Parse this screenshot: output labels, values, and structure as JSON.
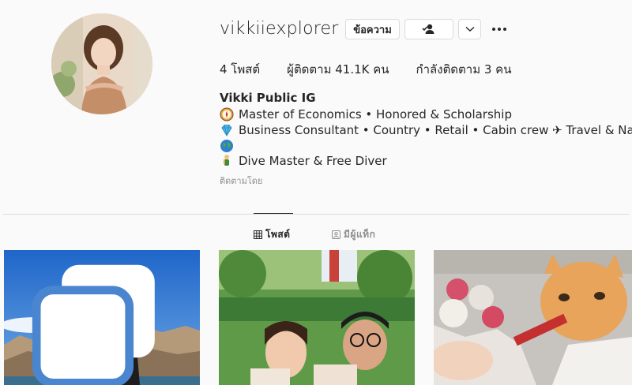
{
  "profile": {
    "username": "vikkiiexplorer",
    "display_name": "Vikki Public IG",
    "bio_lines": [
      "Master of Economics • Honored & Scholarship",
      "Business Consultant • Country • Retail • Cabin crew ✈ Travel & Nature",
      "Dive Master & Free Diver"
    ],
    "followed_by_label": "ติดตามโดย"
  },
  "header": {
    "message_label": "ข้อความ",
    "follow_icon": "person-check-icon",
    "more_icon": "chevron-down-icon",
    "options_icon": "more-dots-icon"
  },
  "stats": {
    "posts": "4 โพสต์",
    "followers": "ผู้ติดตาม 41.1K คน",
    "following": "กำลังติดตาม 3 คน"
  },
  "tabs": [
    {
      "label": "โพสต์",
      "icon": "grid-icon",
      "active": true
    },
    {
      "label": "มีผู้แท็ก",
      "icon": "tag-person-icon",
      "active": false
    }
  ],
  "posts": [
    {
      "subject": "diver on rocky coast",
      "icon": "multi-photo-icon"
    },
    {
      "subject": "couple selfie in garden"
    },
    {
      "subject": "orange cat eating treat"
    }
  ],
  "colors": {
    "background": "#fafafa",
    "text": "#262626",
    "muted": "#8e8e8e",
    "border": "#dbdbdb"
  }
}
